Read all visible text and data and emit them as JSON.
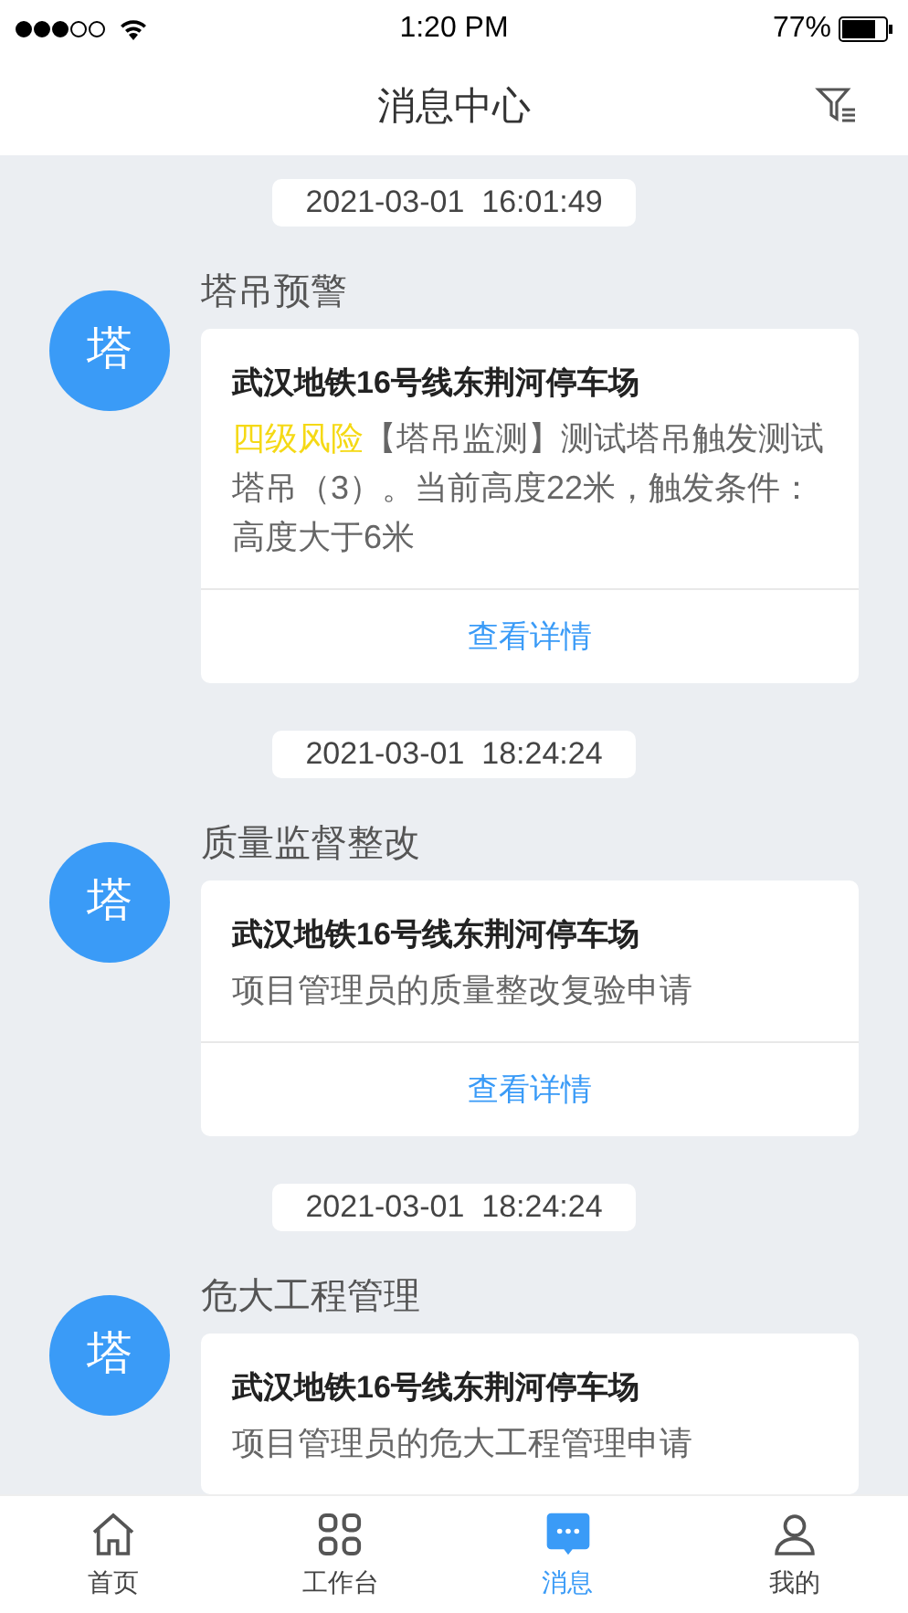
{
  "status_bar": {
    "time": "1:20 PM",
    "battery": "77%"
  },
  "header": {
    "title": "消息中心"
  },
  "messages": [
    {
      "time": "2021-03-01  16:01:49",
      "avatar": "塔",
      "category": "塔吊预警",
      "project": "武汉地铁16号线东荆河停车场",
      "risk": {
        "text": "四级风险",
        "color": "#f5d915"
      },
      "body": "【塔吊监测】测试塔吊触发测试塔吊（3）。当前高度22米，触发条件：高度大于6米",
      "link": "查看详情"
    },
    {
      "time": "2021-03-01  18:24:24",
      "avatar": "塔",
      "category": "质量监督整改",
      "project": "武汉地铁16号线东荆河停车场",
      "body": "项目管理员的质量整改复验申请",
      "link": "查看详情"
    },
    {
      "time": "2021-03-01  18:24:24",
      "avatar": "塔",
      "category": "危大工程管理",
      "project": "武汉地铁16号线东荆河停车场",
      "body": "项目管理员的危大工程管理申请"
    }
  ],
  "tabs": [
    {
      "label": "首页",
      "kind": "home",
      "selected": false
    },
    {
      "label": "工作台",
      "kind": "grid",
      "selected": false
    },
    {
      "label": "消息",
      "kind": "chat",
      "selected": true
    },
    {
      "label": "我的",
      "kind": "user",
      "selected": false
    }
  ]
}
